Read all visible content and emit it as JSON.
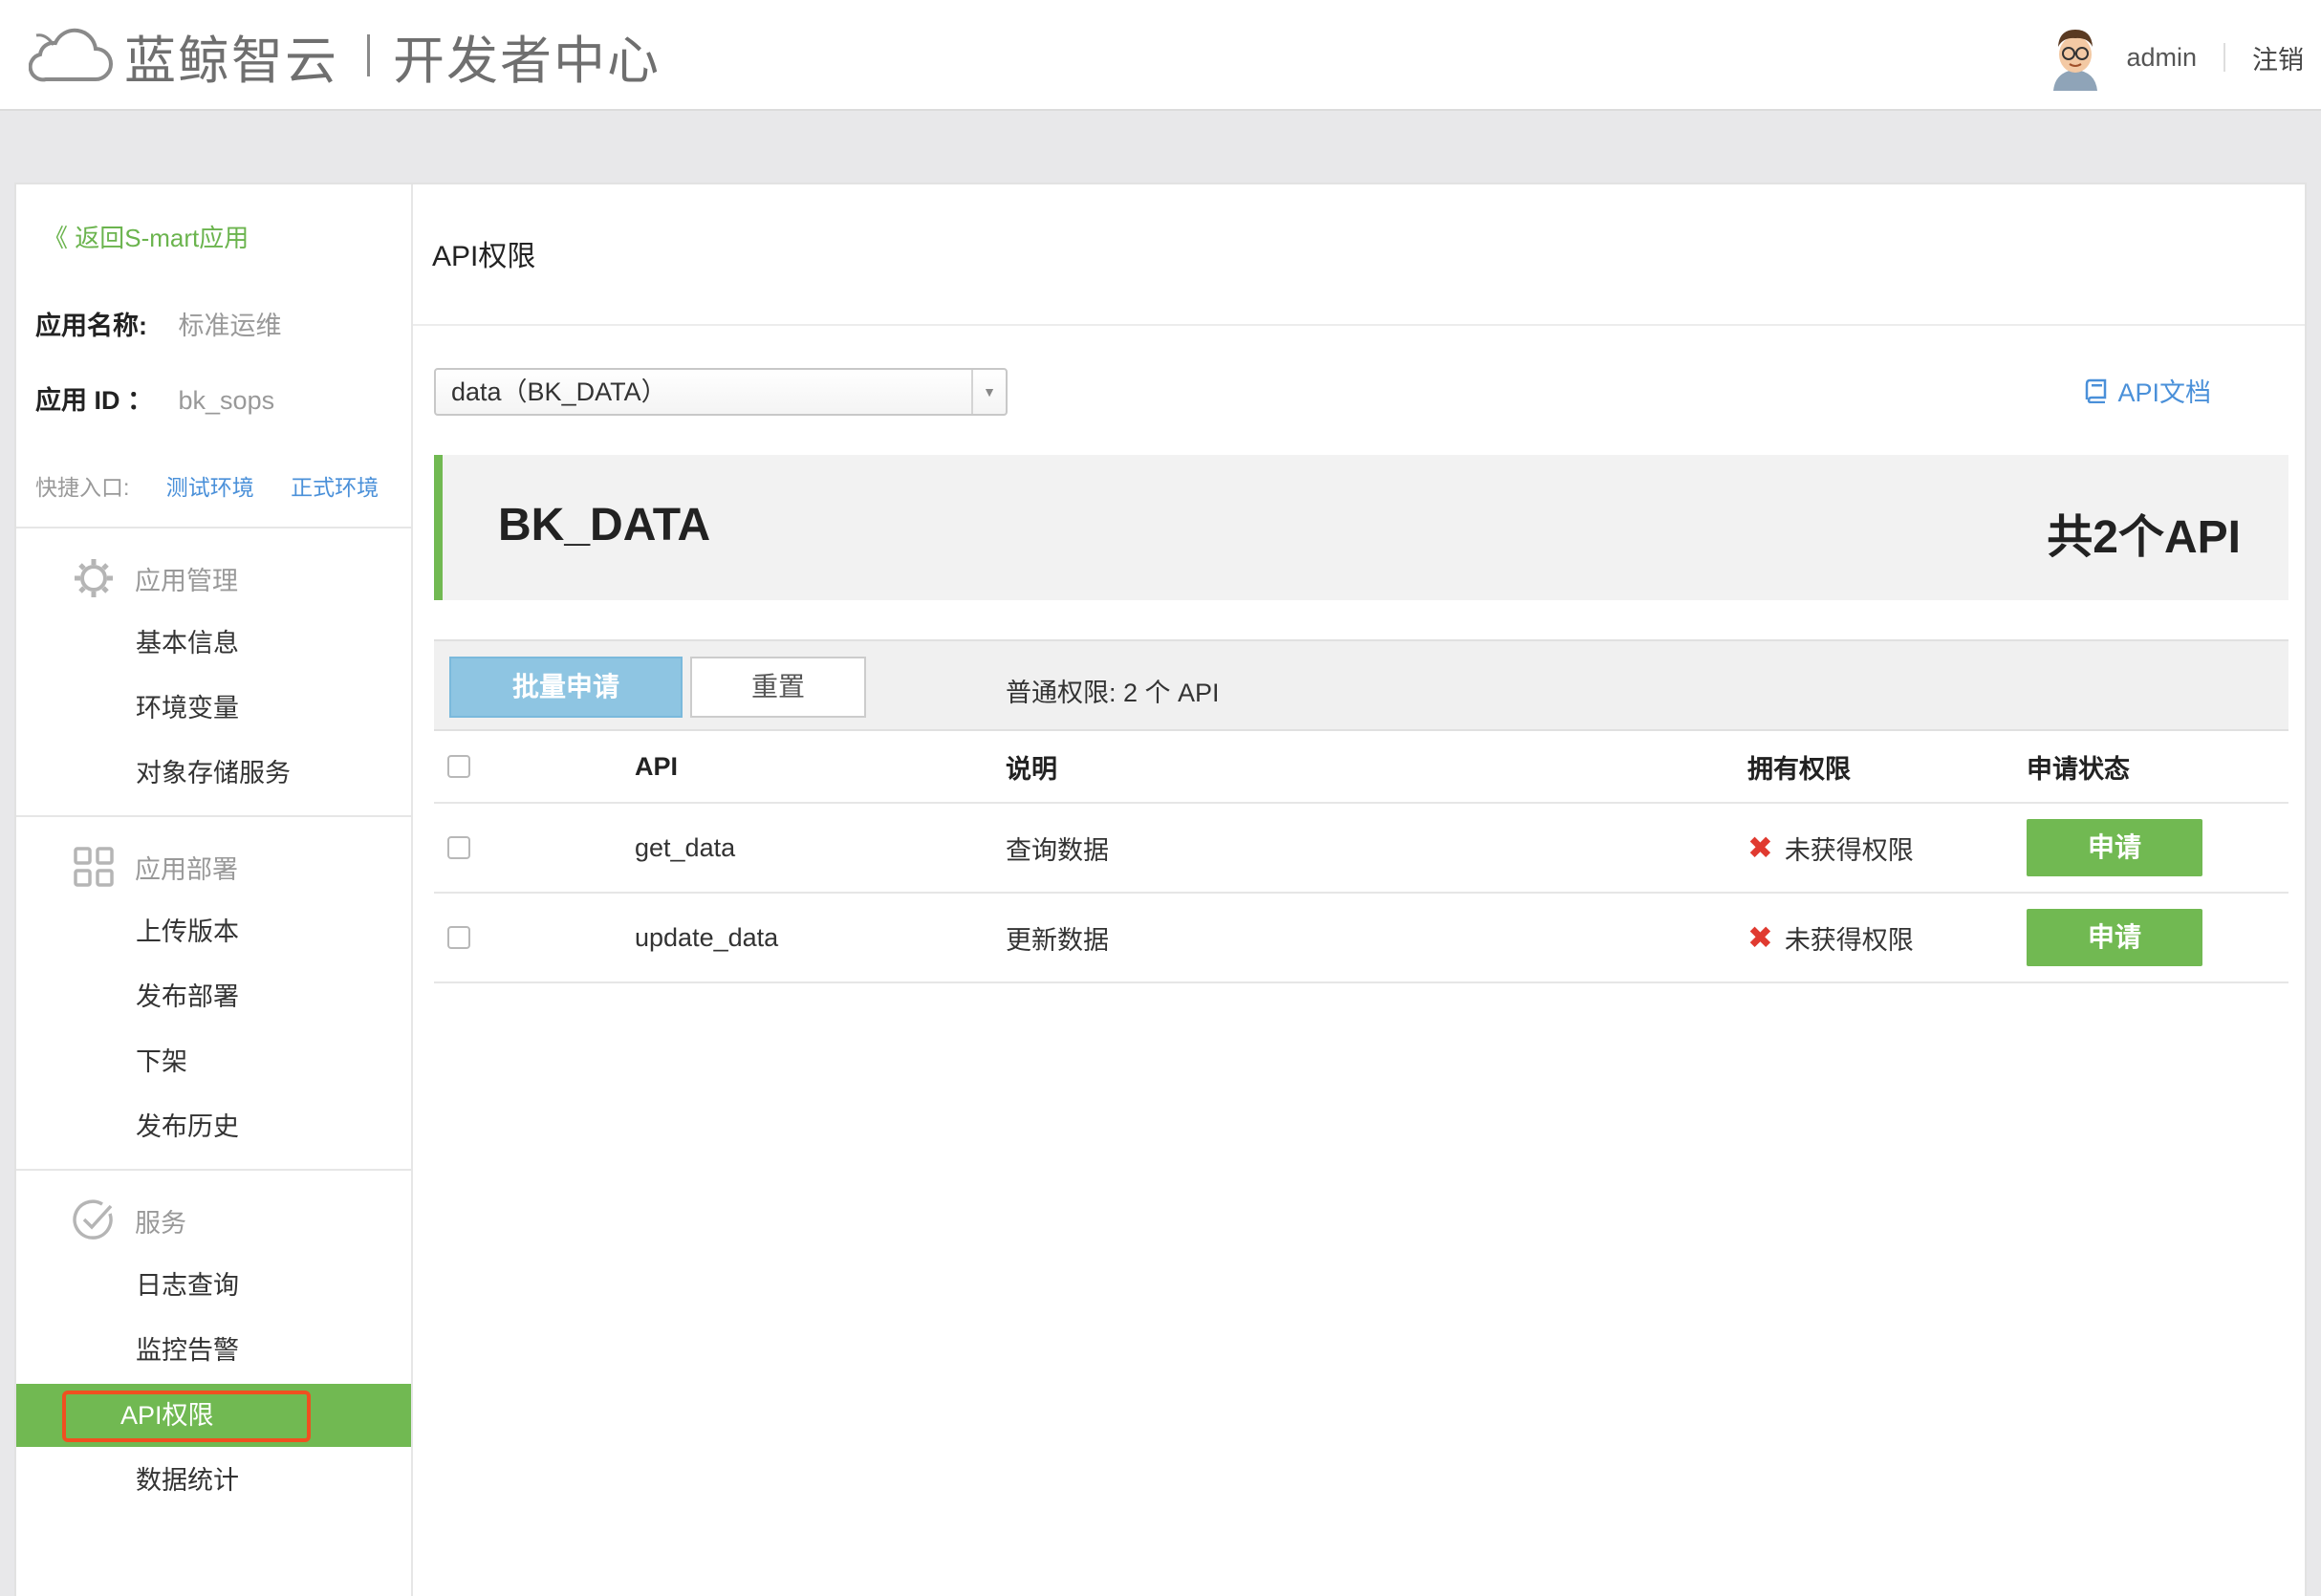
{
  "header": {
    "brand": "蓝鲸智云",
    "portal": "开发者中心",
    "user": "admin",
    "logout": "注销"
  },
  "sidebar": {
    "back": "《 返回S-mart应用",
    "app_name_label": "应用名称:",
    "app_name_value": "标准运维",
    "app_id_label": "应用 ID ：",
    "app_id_value": "bk_sops",
    "quick_label": "快捷入口:",
    "quick_links": [
      "测试环境",
      "正式环境"
    ],
    "groups": [
      {
        "title": "应用管理",
        "icon": "gear-icon",
        "items": [
          "基本信息",
          "环境变量",
          "对象存储服务"
        ]
      },
      {
        "title": "应用部署",
        "icon": "grid-icon",
        "items": [
          "上传版本",
          "发布部署",
          "下架",
          "发布历史"
        ]
      },
      {
        "title": "服务",
        "icon": "check-circle-icon",
        "items": [
          "日志查询",
          "监控告警",
          "API权限",
          "数据统计"
        ]
      }
    ],
    "active_item": "API权限"
  },
  "main": {
    "title": "API权限",
    "select_value": "data（BK_DATA）",
    "doc_link": "API文档",
    "banner_name": "BK_DATA",
    "banner_count": "共2个API",
    "batch_button": "批量申请",
    "reset_button": "重置",
    "count_text": "普通权限: 2 个 API",
    "table": {
      "columns": [
        "API",
        "说明",
        "拥有权限",
        "申请状态"
      ],
      "rows": [
        {
          "api": "get_data",
          "desc": "查询数据",
          "perm": "未获得权限",
          "action": "申请"
        },
        {
          "api": "update_data",
          "desc": "更新数据",
          "perm": "未获得权限",
          "action": "申请"
        }
      ]
    }
  },
  "colors": {
    "accent_green": "#71b952",
    "link_blue": "#4a90d9",
    "error_red": "#e03a30",
    "batch_blue": "#8ec5e2"
  }
}
